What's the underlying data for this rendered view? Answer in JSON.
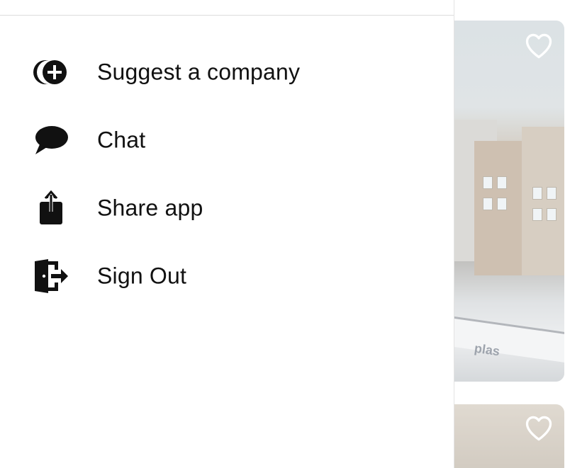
{
  "drawer": {
    "menu": [
      {
        "label": "Suggest a company",
        "icon": "suggest-add-icon"
      },
      {
        "label": "Chat",
        "icon": "chat-bubble-icon"
      },
      {
        "label": "Share app",
        "icon": "share-icon"
      },
      {
        "label": "Sign Out",
        "icon": "sign-out-icon"
      }
    ]
  },
  "background": {
    "cards": [
      {
        "favorite_icon": "heart-outline-icon",
        "boat_text": "plas"
      },
      {
        "favorite_icon": "heart-outline-icon"
      }
    ]
  },
  "colors": {
    "text": "#111111",
    "divider": "#dcdcdc",
    "drawer_bg": "#ffffff"
  }
}
